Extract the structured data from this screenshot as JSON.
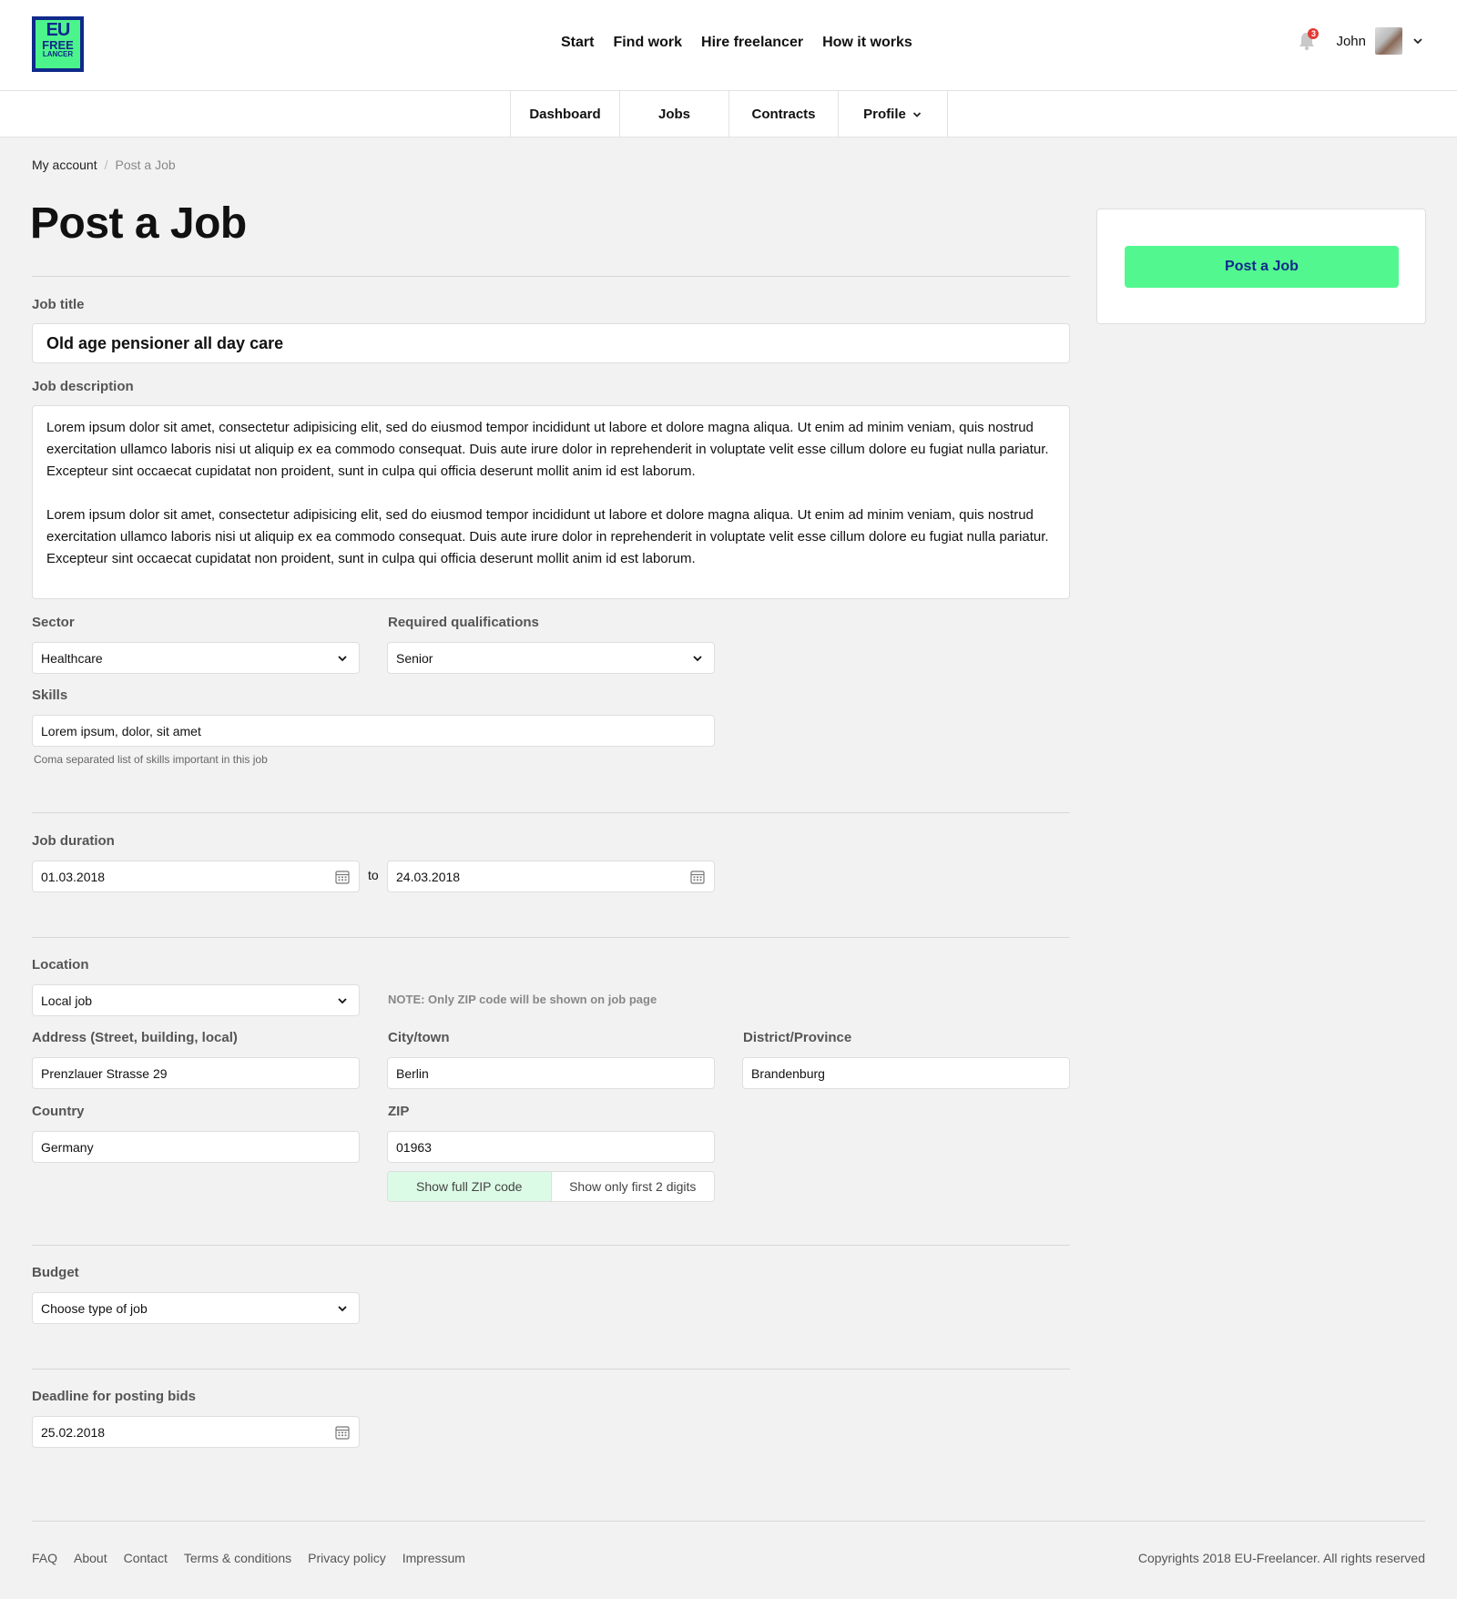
{
  "logo": {
    "line1": "EU",
    "line2": "FREE",
    "line3": "LANCER"
  },
  "nav": {
    "items": [
      "Start",
      "Find work",
      "Hire freelancer",
      "How it works"
    ]
  },
  "user": {
    "notifications": "3",
    "name": "John"
  },
  "subnav": {
    "items": [
      "Dashboard",
      "Jobs",
      "Contracts",
      "Profile"
    ]
  },
  "breadcrumb": {
    "root": "My account",
    "separator": "/",
    "current": "Post a Job"
  },
  "page": {
    "title": "Post a Job"
  },
  "form": {
    "job_title_label": "Job title",
    "job_title_value": "Old age pensioner all day care",
    "description_label": "Job description",
    "description_p1": "Lorem ipsum dolor sit amet, consectetur adipisicing elit, sed do eiusmod tempor incididunt ut labore et dolore magna aliqua. Ut enim ad minim veniam, quis nostrud exercitation ullamco laboris nisi ut aliquip ex ea commodo consequat. Duis aute irure dolor in reprehenderit in voluptate velit esse cillum dolore eu fugiat nulla pariatur. Excepteur sint occaecat cupidatat non proident, sunt in culpa qui officia deserunt mollit anim id est laborum.",
    "description_p2": "Lorem ipsum dolor sit amet, consectetur adipisicing elit, sed do eiusmod tempor incididunt ut labore et dolore magna aliqua. Ut enim ad minim veniam, quis nostrud exercitation ullamco laboris nisi ut aliquip ex ea commodo consequat. Duis aute irure dolor in reprehenderit in voluptate velit esse cillum dolore eu fugiat nulla pariatur. Excepteur sint occaecat cupidatat non proident, sunt in culpa qui officia deserunt mollit anim id est laborum.",
    "sector_label": "Sector",
    "sector_value": "Healthcare",
    "qualifications_label": "Required qualifications",
    "qualifications_value": "Senior",
    "skills_label": "Skills",
    "skills_value": "Lorem ipsum, dolor, sit amet",
    "skills_hint": "Coma separated list of skills important in this job",
    "duration_label": "Job duration",
    "duration_from": "01.03.2018",
    "duration_to_word": "to",
    "duration_to": "24.03.2018",
    "location_label": "Location",
    "location_value": "Local job",
    "location_note": "NOTE: Only ZIP code will be shown on job page",
    "address_label": "Address (Street, building, local)",
    "address_value": "Prenzlauer Strasse 29",
    "city_label": "City/town",
    "city_value": "Berlin",
    "district_label": "District/Province",
    "district_value": "Brandenburg",
    "country_label": "Country",
    "country_value": "Germany",
    "zip_label": "ZIP",
    "zip_value": "01963",
    "zip_full": "Show full ZIP code",
    "zip_partial": "Show only first 2 digits",
    "budget_label": "Budget",
    "budget_value": "Choose type of job",
    "deadline_label": "Deadline for posting bids",
    "deadline_value": "25.02.2018"
  },
  "sidebar": {
    "post_button": "Post a Job"
  },
  "footer": {
    "links": [
      "FAQ",
      "About",
      "Contact",
      "Terms & conditions",
      "Privacy policy",
      "Impressum"
    ],
    "copyright": "Copyrights 2018 EU-Freelancer. All rights reserved"
  },
  "colors": {
    "accent": "#52f88f",
    "brand": "#0f2a8a",
    "badge": "#e53935"
  }
}
